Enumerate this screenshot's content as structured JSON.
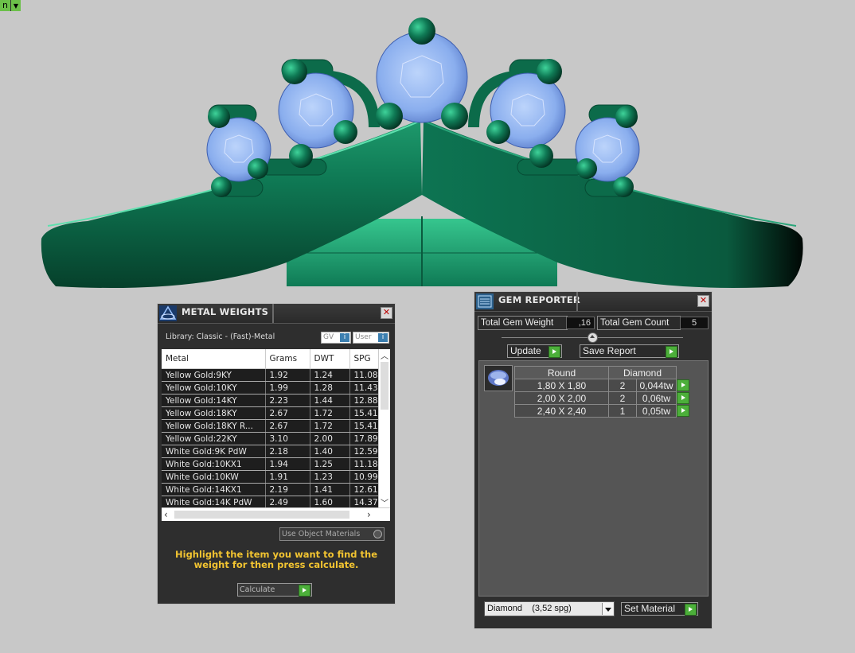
{
  "corner_tab": {
    "label": "n"
  },
  "metal_weights": {
    "title": "METAL WEIGHTS",
    "library_label": "Library: Classic - (Fast)-Metal",
    "gv_label": "GV",
    "user_label": "User",
    "columns": [
      "Metal",
      "Grams",
      "DWT",
      "SPG"
    ],
    "rows": [
      [
        "Yellow Gold:9KY",
        "1.92",
        "1.24",
        "11.08"
      ],
      [
        "Yellow Gold:10KY",
        "1.99",
        "1.28",
        "11.43"
      ],
      [
        "Yellow Gold:14KY",
        "2.23",
        "1.44",
        "12.88"
      ],
      [
        "Yellow Gold:18KY",
        "2.67",
        "1.72",
        "15.41"
      ],
      [
        "Yellow Gold:18KY R...",
        "2.67",
        "1.72",
        "15.41"
      ],
      [
        "Yellow Gold:22KY",
        "3.10",
        "2.00",
        "17.89"
      ],
      [
        "White Gold:9K PdW",
        "2.18",
        "1.40",
        "12.59"
      ],
      [
        "White Gold:10KX1",
        "1.94",
        "1.25",
        "11.18"
      ],
      [
        "White Gold:10KW",
        "1.91",
        "1.23",
        "10.99"
      ],
      [
        "White Gold:14KX1",
        "2.19",
        "1.41",
        "12.61"
      ],
      [
        "White Gold:14K PdW",
        "2.49",
        "1.60",
        "14.37"
      ]
    ],
    "use_object_materials": "Use Object Materials",
    "hint": "Highlight the item you want to find the weight for then press calculate.",
    "calculate_label": "Calculate"
  },
  "gem_reporter": {
    "title": "GEM REPORTER",
    "total_weight_label": "Total Gem Weight",
    "total_weight_value": ",16",
    "total_count_label": "Total Gem Count",
    "total_count_value": "5",
    "update_label": "Update",
    "save_report_label": "Save Report",
    "table_headers": [
      "Round",
      "Diamond"
    ],
    "gem_rows": [
      {
        "size": "1,80 X 1,80",
        "count": "2",
        "weight": "0,044tw"
      },
      {
        "size": "2,00 X 2,00",
        "count": "2",
        "weight": "0,06tw"
      },
      {
        "size": "2,40 X 2,40",
        "count": "1",
        "weight": "0,05tw"
      }
    ],
    "material_select": "Diamond    (3,52 spg)",
    "set_material_label": "Set Material"
  },
  "colors": {
    "metal": "#0e6b4c",
    "gem": "#8fb4f0",
    "hint": "#f2c431",
    "accent_green": "#4caf3a",
    "background": "#c8c8c8"
  }
}
